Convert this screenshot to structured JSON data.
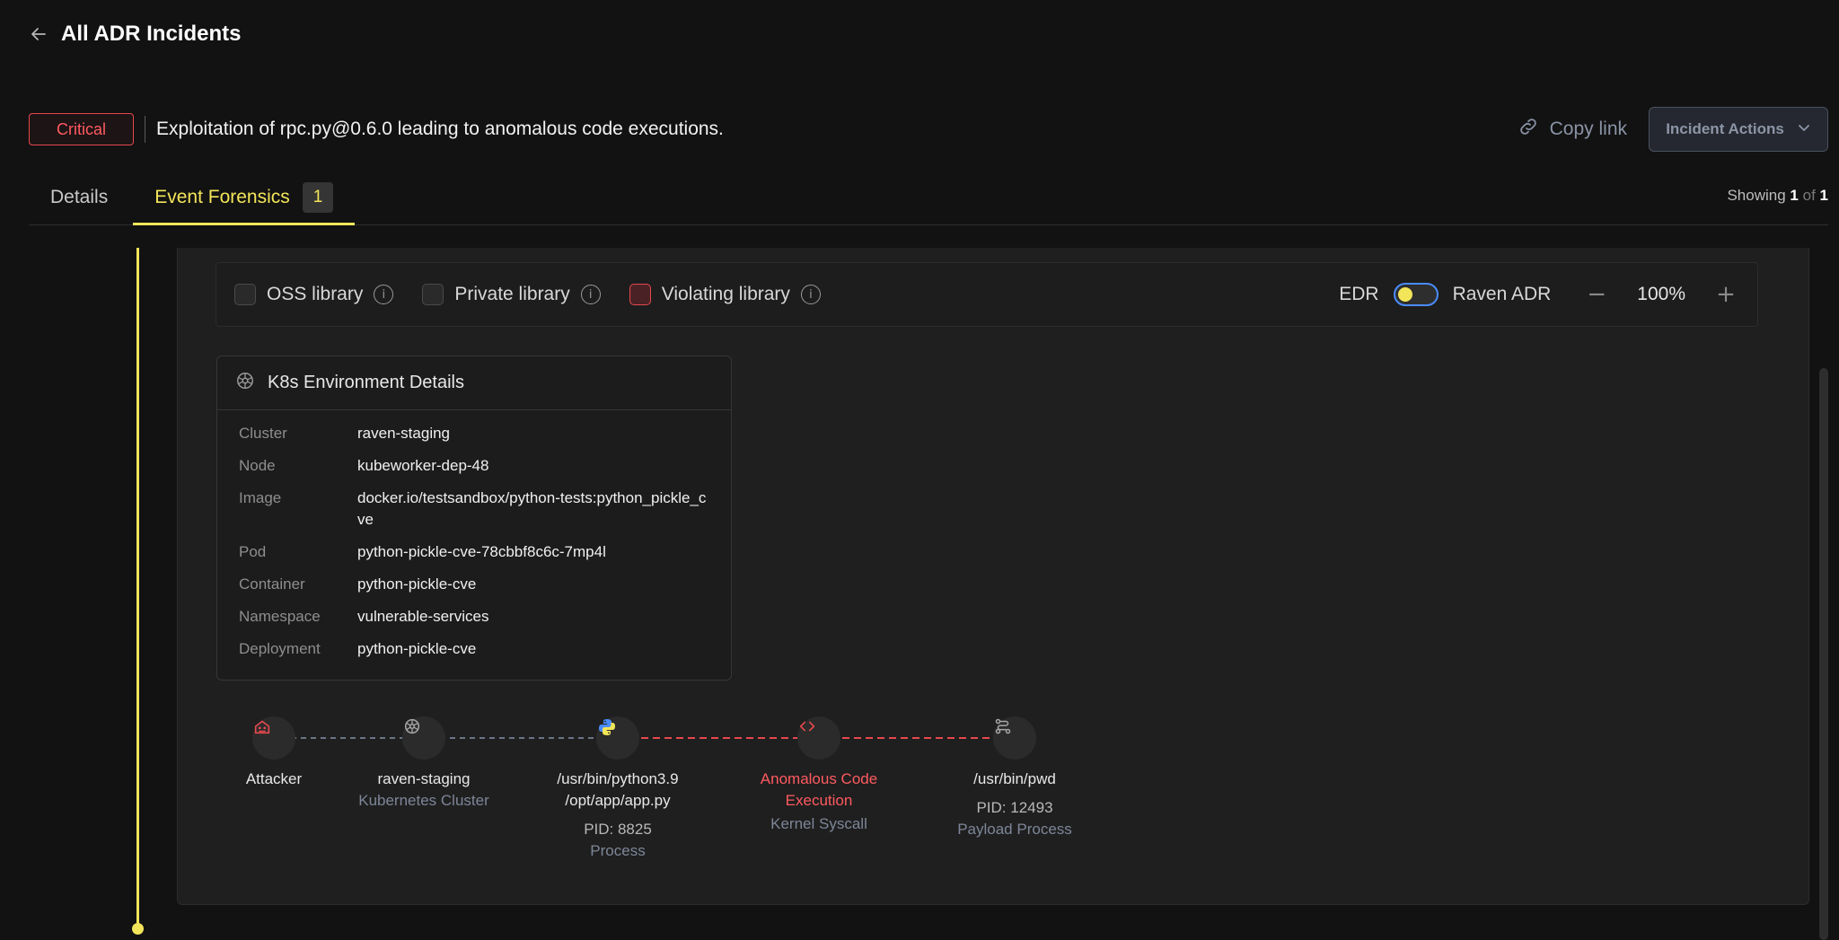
{
  "header": {
    "title": "All ADR Incidents"
  },
  "incident": {
    "severity": "Critical",
    "title": "Exploitation of rpc.py@0.6.0 leading to anomalous code executions.",
    "copy_link": "Copy link",
    "actions": "Incident Actions"
  },
  "tabs": [
    {
      "label": "Details"
    },
    {
      "label": "Event Forensics",
      "count": "1"
    }
  ],
  "showing": {
    "prefix": "Showing",
    "current": "1",
    "of": "of",
    "total": "1"
  },
  "filters": {
    "oss": "OSS library",
    "private": "Private library",
    "violating": "Violating library",
    "edr": "EDR",
    "raven_adr": "Raven ADR",
    "zoom": "100%"
  },
  "k8s": {
    "title": "K8s Environment Details",
    "rows": [
      {
        "key": "Cluster",
        "value": "raven-staging"
      },
      {
        "key": "Node",
        "value": "kubeworker-dep-48"
      },
      {
        "key": "Image",
        "value": "docker.io/testsandbox/python-tests:python_pickle_cve"
      },
      {
        "key": "Pod",
        "value": "python-pickle-cve-78cbbf8c6c-7mp4l"
      },
      {
        "key": "Container",
        "value": "python-pickle-cve"
      },
      {
        "key": "Namespace",
        "value": "vulnerable-services"
      },
      {
        "key": "Deployment",
        "value": "python-pickle-cve"
      }
    ]
  },
  "flow": {
    "attacker": {
      "label": "Attacker"
    },
    "cluster": {
      "label": "raven-staging",
      "sub": "Kubernetes Cluster"
    },
    "process": {
      "line1": "/usr/bin/python3.9",
      "line2": "/opt/app/app.py",
      "pid": "PID: 8825",
      "sub": "Process"
    },
    "syscall": {
      "line1": "Anomalous Code",
      "line2": "Execution",
      "sub": "Kernel Syscall"
    },
    "payload": {
      "label": "/usr/bin/pwd",
      "pid": "PID: 12493",
      "sub": "Payload Process"
    }
  },
  "colors": {
    "accent": "#f3e55a",
    "critical": "#e5484d",
    "link_blue": "#4a8cff"
  }
}
